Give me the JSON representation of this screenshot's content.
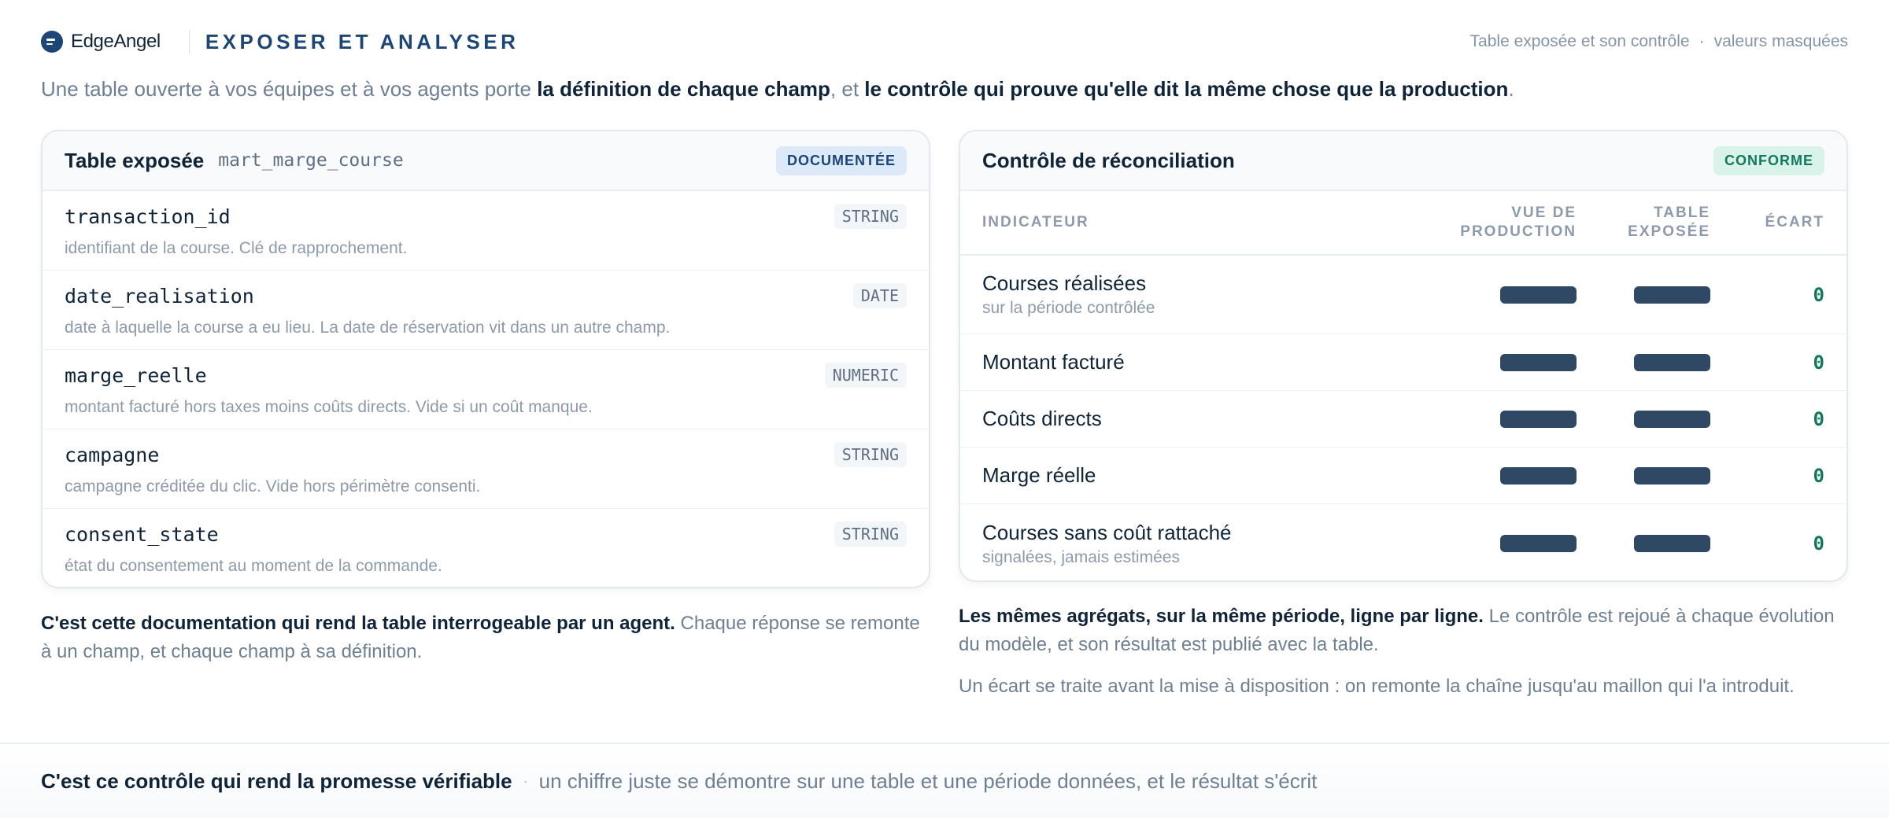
{
  "brand": {
    "name": "EdgeAngel"
  },
  "header": {
    "title": "EXPOSER ET ANALYSER",
    "meta_left": "Table exposée et son contrôle",
    "meta_sep": "·",
    "meta_right": "valeurs masquées"
  },
  "intro": {
    "part1": "Une table ouverte à vos équipes et à vos agents porte ",
    "bold1": "la définition de chaque champ",
    "part2": ", et ",
    "bold2": "le contrôle qui prouve qu'elle dit la même chose que la production",
    "part3": "."
  },
  "table_card": {
    "title": "Table exposée",
    "table_name": "mart_marge_course",
    "badge": "DOCUMENTÉE",
    "fields": [
      {
        "name": "transaction_id",
        "type": "STRING",
        "desc": "identifiant de la course. Clé de rapprochement."
      },
      {
        "name": "date_realisation",
        "type": "DATE",
        "desc": "date à laquelle la course a eu lieu. La date de réservation vit dans un autre champ."
      },
      {
        "name": "marge_reelle",
        "type": "NUMERIC",
        "desc": "montant facturé hors taxes moins coûts directs. Vide si un coût manque."
      },
      {
        "name": "campagne",
        "type": "STRING",
        "desc": "campagne créditée du clic. Vide hors périmètre consenti."
      },
      {
        "name": "consent_state",
        "type": "STRING",
        "desc": "état du consentement au moment de la commande."
      }
    ]
  },
  "recon_card": {
    "title": "Contrôle de réconciliation",
    "badge": "CONFORME",
    "columns": {
      "indicator": "INDICATEUR",
      "prod_1": "VUE DE",
      "prod_2": "PRODUCTION",
      "exposed_1": "TABLE",
      "exposed_2": "EXPOSÉE",
      "gap": "ÉCART"
    },
    "rows": [
      {
        "label": "Courses réalisées",
        "sub": "sur la période contrôlée",
        "gap": "0"
      },
      {
        "label": "Montant facturé",
        "sub": "",
        "gap": "0"
      },
      {
        "label": "Coûts directs",
        "sub": "",
        "gap": "0"
      },
      {
        "label": "Marge réelle",
        "sub": "",
        "gap": "0"
      },
      {
        "label": "Courses sans coût rattaché",
        "sub": "signalées, jamais estimées",
        "gap": "0"
      }
    ]
  },
  "caption_left": {
    "bold": "C'est cette documentation qui rend la table interrogeable par un agent.",
    "text": " Chaque réponse se remonte à un champ, et chaque champ à sa définition."
  },
  "caption_right": {
    "bold": "Les mêmes agrégats, sur la même période, ligne par ligne.",
    "text": " Le contrôle est rejoué à chaque évolution du modèle, et son résultat est publié avec la table.",
    "second": "Un écart se traite avant la mise à disposition : on remonte la chaîne jusqu'au maillon qui l'a introduit."
  },
  "footer": {
    "bold": "C'est ce contrôle qui rend la promesse vérifiable",
    "sep": "·",
    "text": "un chiffre juste se démontre sur une table et une période données, et le résultat s'écrit"
  },
  "colors": {
    "accent": "#1d4676",
    "success": "#13795e",
    "mask": "#2f4864"
  },
  "icons": {
    "brand_logo": "edgeangel-logo-icon"
  }
}
